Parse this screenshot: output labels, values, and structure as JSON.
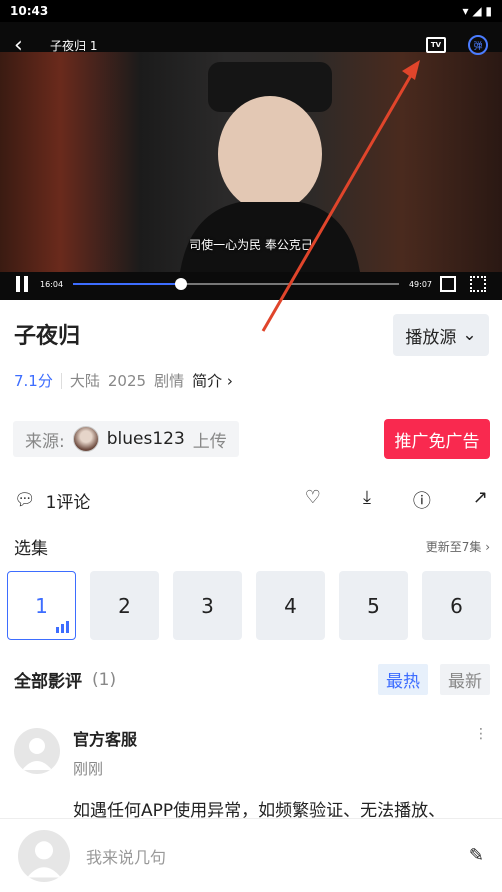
{
  "status_bar": {
    "time": "10:43",
    "right": "▾ ◢ ▮"
  },
  "player": {
    "title": "子夜归 1",
    "tv_label": "TV",
    "danmu_label": "弹",
    "subtitle": "司使一心为民 奉公克己",
    "current_time": "16:04",
    "total_time": "49:07",
    "progress": 0.33
  },
  "show": {
    "title": "子夜归",
    "source_button": "播放源",
    "score": "7.1分",
    "region": "大陆",
    "year": "2025",
    "genre": "剧情",
    "intro_label": "简介",
    "uploader_prefix": "来源:",
    "uploader_name": "blues123",
    "uploader_suffix": "上传",
    "adfree_button": "推广免广告"
  },
  "actions": {
    "comment_count": "1评论"
  },
  "episodes": {
    "label": "选集",
    "update_label": "更新至7集",
    "items": [
      "1",
      "2",
      "3",
      "4",
      "5",
      "6"
    ]
  },
  "reviews": {
    "label": "全部影评",
    "count": "(1)",
    "sort_hot": "最热",
    "sort_new": "最新",
    "first": {
      "author": "官方客服",
      "time": "刚刚",
      "text": "如遇任何APP使用异常，如频繁验证、无法播放、"
    }
  },
  "comment_input": {
    "placeholder": "我来说几句"
  },
  "colors": {
    "accent": "#3d6dff",
    "adfree": "#f9294f",
    "arrow": "#e0452b"
  }
}
